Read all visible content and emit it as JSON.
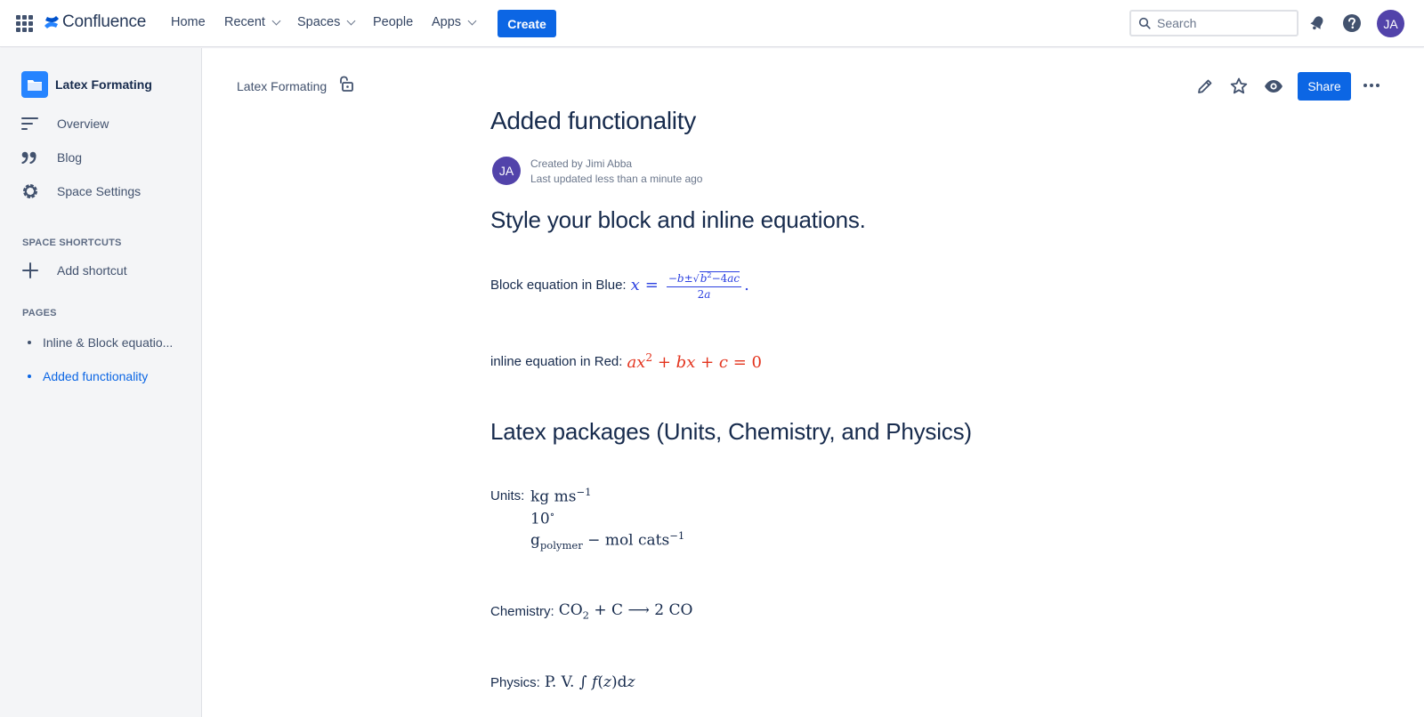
{
  "topnav": {
    "brand": "Confluence",
    "items": [
      {
        "label": "Home"
      },
      {
        "label": "Recent"
      },
      {
        "label": "Spaces"
      },
      {
        "label": "People"
      },
      {
        "label": "Apps"
      }
    ],
    "create_label": "Create",
    "search_placeholder": "Search",
    "user_initials": "JA"
  },
  "sidebar": {
    "space_name": "Latex Formating",
    "nav": [
      {
        "label": "Overview"
      },
      {
        "label": "Blog"
      },
      {
        "label": "Space Settings"
      }
    ],
    "shortcuts_heading": "SPACE SHORTCUTS",
    "add_shortcut_label": "Add shortcut",
    "pages_heading": "PAGES",
    "pages": [
      {
        "label": "Inline & Block equatio..."
      },
      {
        "label": "Added functionality"
      }
    ]
  },
  "content": {
    "breadcrumb": "Latex Formating",
    "share_label": "Share",
    "title": "Added functionality",
    "author_initials": "JA",
    "created_by": "Created by Jimi Abba",
    "last_updated": "Last updated less than a minute ago",
    "heading1": "Style your block and inline equations.",
    "block_label": "Block equation in Blue:",
    "inline_label": "inline equation in Red:",
    "heading2": "Latex packages (Units, Chemistry, and Physics)",
    "units_label": "Units:",
    "chemistry_label": "Chemistry:",
    "physics_label": "Physics:"
  },
  "colors": {
    "primary": "#0c66e4",
    "equation_blue": "#2a3fe0",
    "equation_red": "#e3341e",
    "avatar": "#5243aa",
    "space_icon": "#2684ff"
  }
}
